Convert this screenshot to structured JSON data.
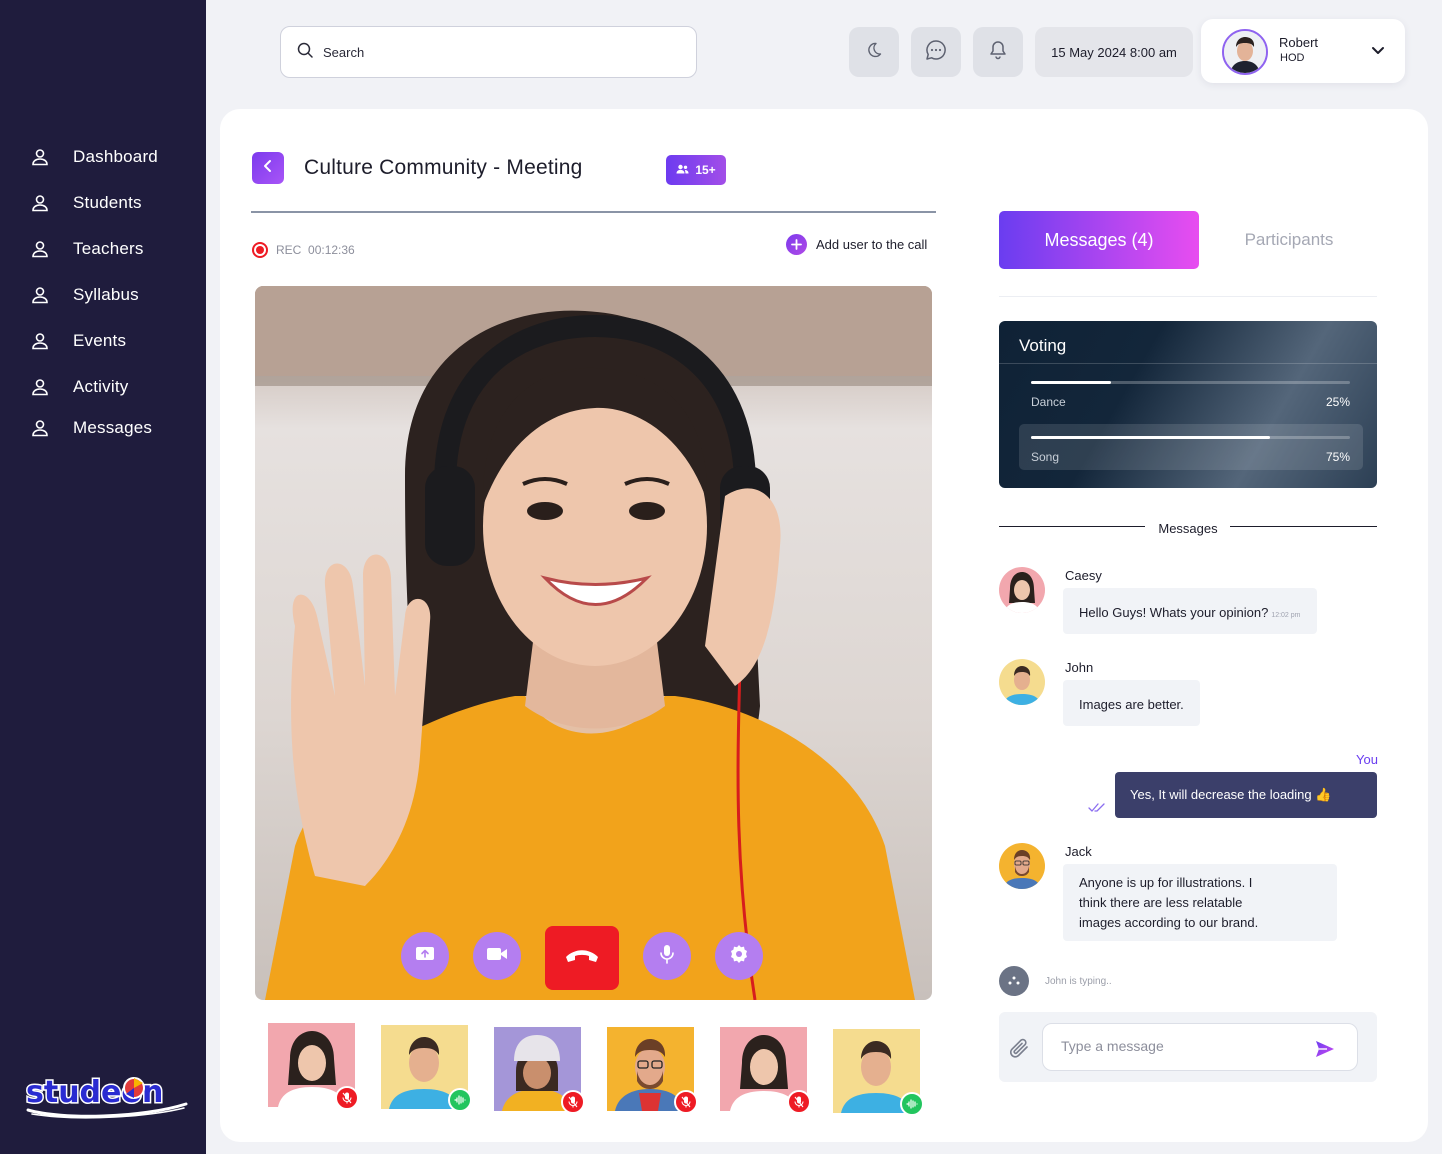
{
  "sidebar": {
    "items": [
      {
        "label": "Dashboard",
        "icon": "user-icon"
      },
      {
        "label": "Students",
        "icon": "user-icon"
      },
      {
        "label": "Teachers",
        "icon": "user-icon"
      },
      {
        "label": "Syllabus",
        "icon": "user-icon"
      },
      {
        "label": "Events",
        "icon": "user-icon"
      },
      {
        "label": "Activity",
        "icon": "user-icon"
      },
      {
        "label": "Messages",
        "icon": "user-icon"
      }
    ],
    "logo_text": "studeon"
  },
  "header": {
    "search_placeholder": "Search",
    "icons": [
      "moon-icon",
      "chat-icon",
      "bell-icon"
    ],
    "datetime": "15 May 2024 8:00 am",
    "user": {
      "name": "Robert",
      "role": "HOD"
    }
  },
  "meeting": {
    "title": "Culture Community - Meeting",
    "participants_badge": "15+",
    "rec_label": "REC",
    "rec_time": "00:12:36",
    "add_user_label": "Add user to the call",
    "controls": [
      "share-screen-icon",
      "video-camera-icon",
      "end-call-icon",
      "microphone-icon",
      "settings-icon"
    ],
    "thumbnails": [
      {
        "person": "woman-pink-bg",
        "mic": "muted"
      },
      {
        "person": "man-yellow-bg",
        "mic": "speaking"
      },
      {
        "person": "woman-beanie-purple-bg",
        "mic": "muted"
      },
      {
        "person": "man-glasses-orange-bg",
        "mic": "muted"
      },
      {
        "person": "woman-pink-bg",
        "mic": "muted"
      },
      {
        "person": "man-yellow-bg",
        "mic": "speaking"
      }
    ]
  },
  "panel": {
    "tabs": {
      "messages": "Messages (4)",
      "participants": "Participants"
    },
    "voting": {
      "title": "Voting",
      "options": [
        {
          "label": "Dance",
          "percent_text": "25%",
          "value": 0.25
        },
        {
          "label": "Song",
          "percent_text": "75%",
          "value": 0.75
        }
      ]
    },
    "messages_heading": "Messages",
    "messages": [
      {
        "name": "Caesy",
        "lines": [
          "Hello Guys! Whats your opinion?"
        ],
        "time": "12:02 pm"
      },
      {
        "name": "John",
        "lines": [
          "Images are better."
        ]
      },
      {
        "name": "You",
        "lines": [
          "Yes, It will decrease the loading 👍"
        ]
      },
      {
        "name": "Jack",
        "lines": [
          "Anyone is up for illustrations. I",
          "think there are less relatable",
          "images according to our brand."
        ]
      }
    ],
    "typing": "John is typing..",
    "compose_placeholder": "Type a message"
  },
  "colors": {
    "sidebar": "#1f1c3d",
    "accent": "#7c3aed",
    "end_call": "#ee1b24",
    "muted": "#ee1b24",
    "speaking": "#22c55e",
    "you_bubble": "#3b3f6a"
  }
}
